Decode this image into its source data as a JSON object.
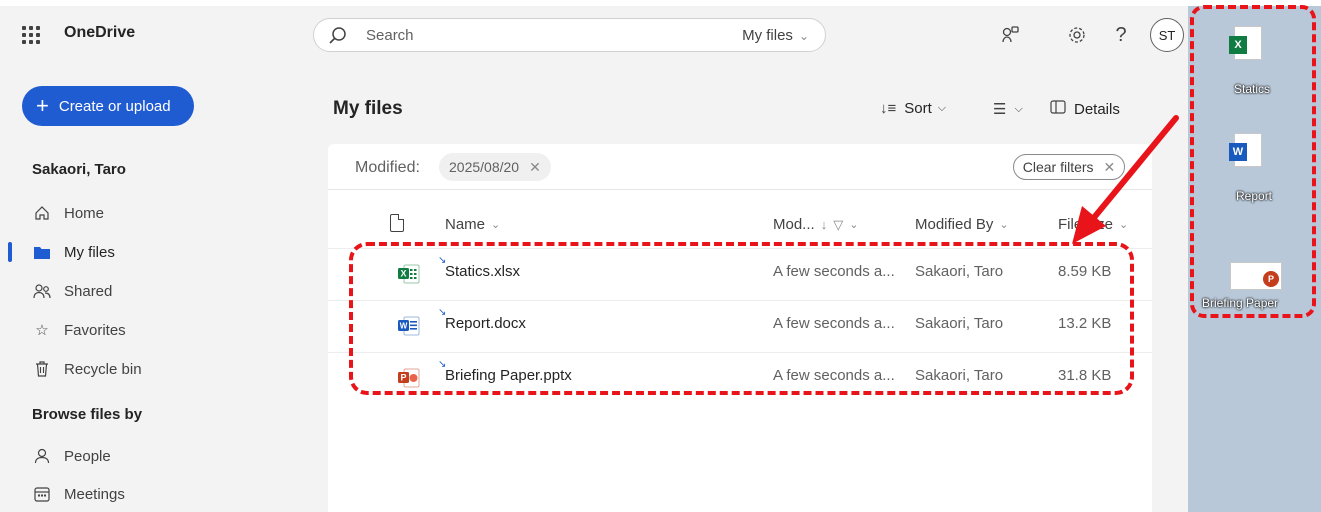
{
  "header": {
    "app_name": "OneDrive",
    "search_placeholder": "Search",
    "search_scope": "My files",
    "avatar_initials": "ST",
    "help_glyph": "?"
  },
  "sidebar": {
    "create_label": "Create or upload",
    "user_name": "Sakaori, Taro",
    "items": [
      {
        "label": "Home",
        "icon": "home-icon"
      },
      {
        "label": "My files",
        "icon": "folder-icon"
      },
      {
        "label": "Shared",
        "icon": "people-icon"
      },
      {
        "label": "Favorites",
        "icon": "star-icon"
      },
      {
        "label": "Recycle bin",
        "icon": "trash-icon"
      }
    ],
    "browse_heading": "Browse files by",
    "browse_items": [
      {
        "label": "People",
        "icon": "person-icon"
      },
      {
        "label": "Meetings",
        "icon": "calendar-icon"
      }
    ]
  },
  "main": {
    "title": "My files",
    "toolbar": {
      "sort_label": "Sort",
      "details_label": "Details"
    },
    "filter": {
      "label": "Modified:",
      "chip": "2025/08/20",
      "clear_label": "Clear filters"
    },
    "columns": {
      "name": "Name",
      "modified": "Mod...",
      "modified_by": "Modified By",
      "file_size": "File size"
    },
    "files": [
      {
        "name": "Statics.xlsx",
        "type": "excel",
        "modified": "A few seconds a...",
        "modified_by": "Sakaori, Taro",
        "size": "8.59 KB"
      },
      {
        "name": "Report.docx",
        "type": "word",
        "modified": "A few seconds a...",
        "modified_by": "Sakaori, Taro",
        "size": "13.2 KB"
      },
      {
        "name": "Briefing Paper.pptx",
        "type": "powerpoint",
        "modified": "A few seconds a...",
        "modified_by": "Sakaori, Taro",
        "size": "31.8 KB"
      }
    ]
  },
  "desktop": {
    "icons": [
      {
        "label": "Statics",
        "type": "excel"
      },
      {
        "label": "Report",
        "type": "word"
      },
      {
        "label": "Briefing Paper",
        "type": "powerpoint"
      }
    ]
  },
  "colors": {
    "accent": "#1f5bd1",
    "annotation": "#e8141a",
    "excel": "#107c41",
    "word": "#185abd",
    "powerpoint": "#c43e1c"
  }
}
